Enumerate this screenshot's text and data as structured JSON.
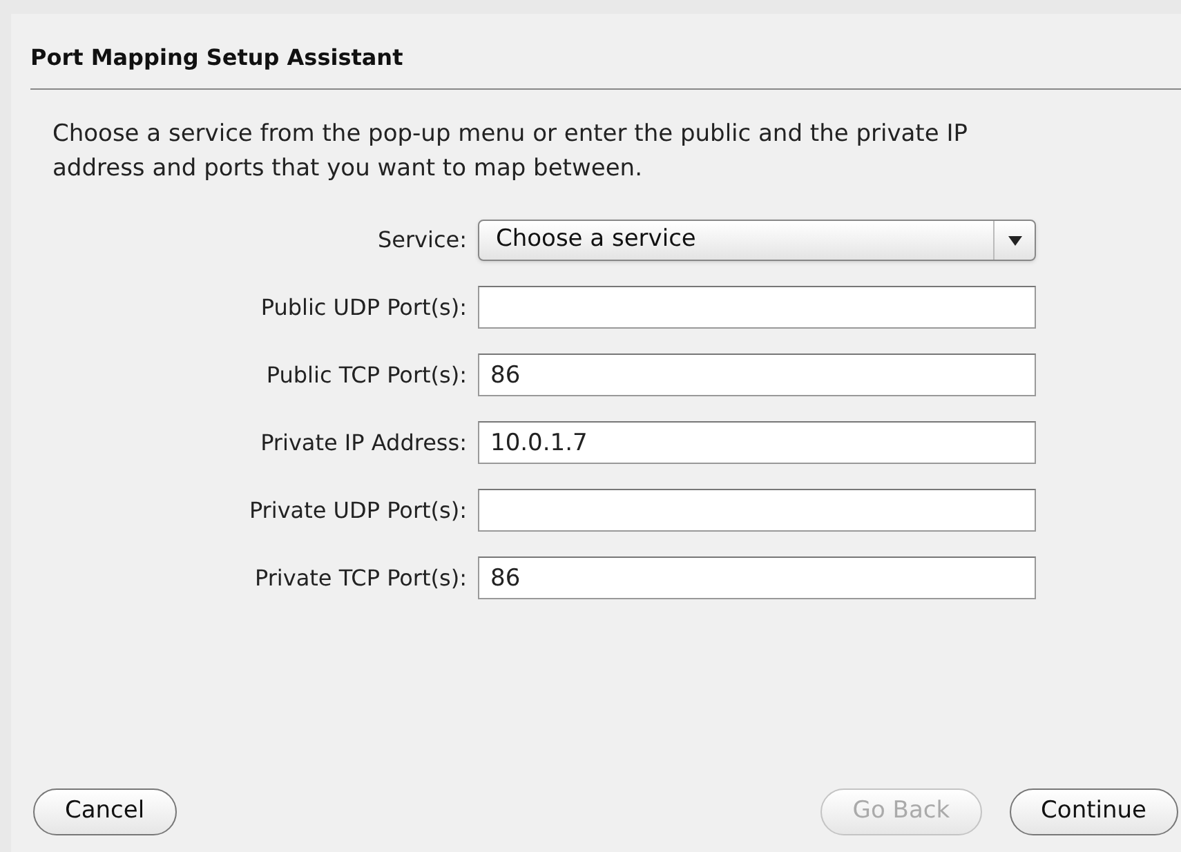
{
  "sheet": {
    "title": "Port Mapping Setup Assistant",
    "instructions": "Choose a service from the pop-up menu or enter the public and the private IP address and ports that you want to map between.",
    "fields": [
      {
        "kind": "popup",
        "label": "Service:",
        "value": "Choose a service"
      },
      {
        "kind": "text",
        "label": "Public UDP Port(s):"
      },
      {
        "kind": "text",
        "label": "Public TCP Port(s):",
        "value": "86"
      },
      {
        "kind": "text",
        "label": "Private IP Address:",
        "value": "10.0.1.7"
      },
      {
        "kind": "text",
        "label": "Private UDP Port(s):"
      },
      {
        "kind": "text",
        "label": "Private TCP Port(s):",
        "value": "86"
      }
    ],
    "buttons": [
      {
        "label": "Cancel",
        "disabled": false
      },
      {
        "label": "Go Back",
        "disabled": true
      },
      {
        "label": "Continue",
        "disabled": false
      }
    ]
  }
}
